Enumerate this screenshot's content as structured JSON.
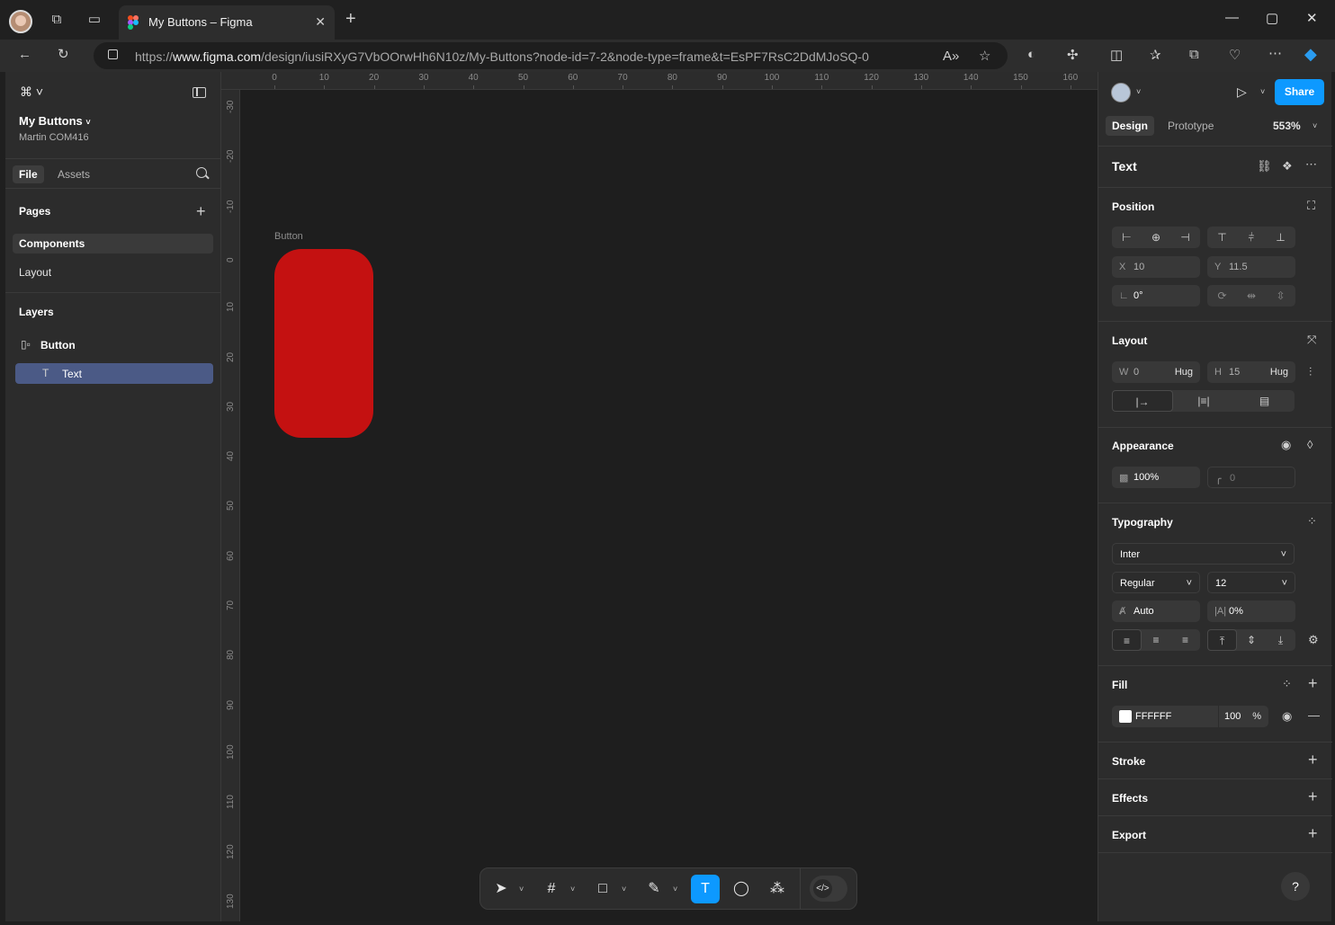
{
  "browser": {
    "tab_title": "My Buttons – Figma",
    "url_prefix": "https://",
    "url_domain": "www.figma.com",
    "url_path": "/design/iusiRXyG7VbOOrwHh6N10z/My-Buttons?node-id=7-2&node-type=frame&t=EsPF7RsC2DdMJoSQ-0"
  },
  "left_panel": {
    "project_name": "My Buttons",
    "team_name": "Martin COM416",
    "tabs": [
      "File",
      "Assets"
    ],
    "pages_heading": "Pages",
    "pages": [
      "Components",
      "Layout"
    ],
    "layers_heading": "Layers",
    "layers": [
      {
        "name": "Button",
        "icon": "frame-autolayout-icon"
      },
      {
        "name": "Text",
        "icon": "text-icon"
      }
    ]
  },
  "rulers": {
    "top": [
      "0",
      "10",
      "20",
      "30",
      "40",
      "50",
      "60",
      "70",
      "80",
      "90",
      "100",
      "110",
      "120",
      "130",
      "140",
      "150",
      "160"
    ],
    "left": [
      "-30",
      "-20",
      "-10",
      "0",
      "10",
      "20",
      "30",
      "40",
      "50",
      "60",
      "70",
      "80",
      "90",
      "100",
      "110",
      "120",
      "130"
    ]
  },
  "canvas": {
    "frame_label": "Button",
    "button_color": "#c41111"
  },
  "right_panel": {
    "share_label": "Share",
    "tabs": [
      "Design",
      "Prototype"
    ],
    "zoom": "553%",
    "selection_title": "Text",
    "position": {
      "heading": "Position",
      "x_label": "X",
      "x_value": "10",
      "y_label": "Y",
      "y_value": "11.5",
      "rotation": "0°"
    },
    "layout": {
      "heading": "Layout",
      "w_label": "W",
      "w_value": "0",
      "w_mode": "Hug",
      "h_label": "H",
      "h_value": "15",
      "h_mode": "Hug"
    },
    "appearance": {
      "heading": "Appearance",
      "opacity": "100%",
      "radius": "0"
    },
    "typography": {
      "heading": "Typography",
      "font": "Inter",
      "weight": "Regular",
      "size": "12",
      "line_height": "Auto",
      "letter_spacing": "0%"
    },
    "fill": {
      "heading": "Fill",
      "hex": "FFFFFF",
      "opacity": "100",
      "percent": "%"
    },
    "stroke_heading": "Stroke",
    "effects_heading": "Effects",
    "export_heading": "Export",
    "help": "?"
  },
  "accent_color": "#0d99ff"
}
